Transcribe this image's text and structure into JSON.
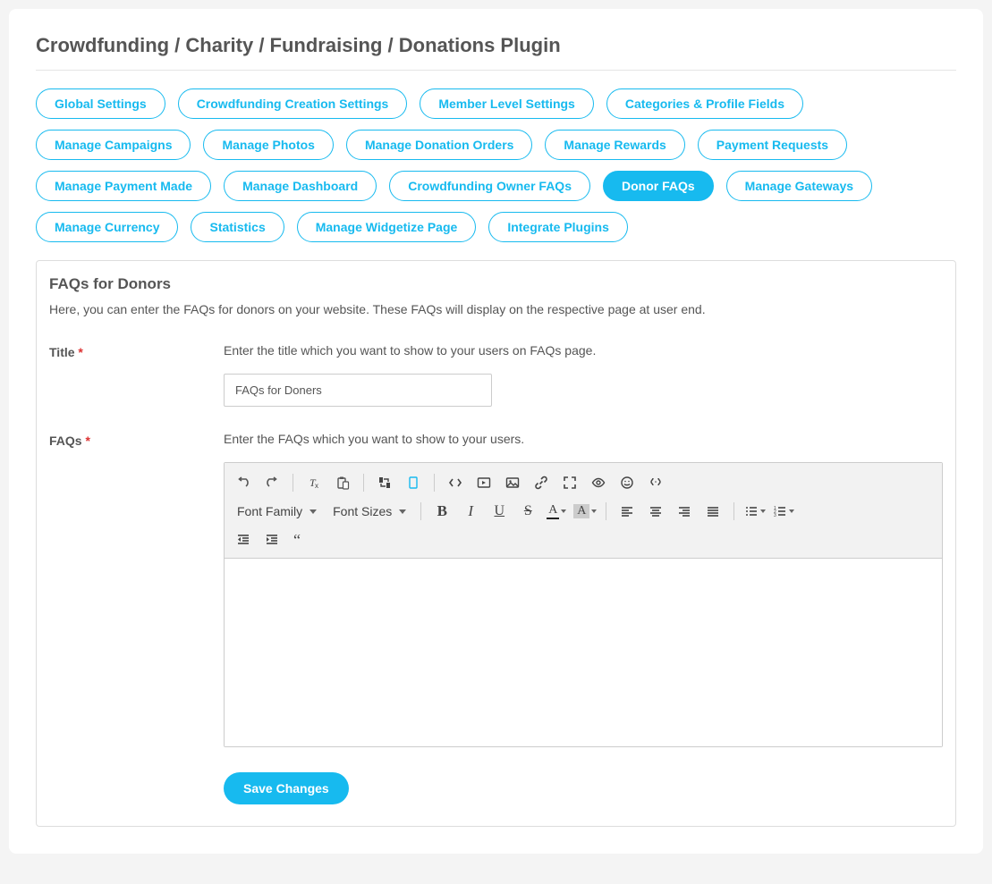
{
  "page_title": "Crowdfunding / Charity / Fundraising / Donations Plugin",
  "tabs": [
    {
      "label": "Global Settings",
      "active": false
    },
    {
      "label": "Crowdfunding Creation Settings",
      "active": false
    },
    {
      "label": "Member Level Settings",
      "active": false
    },
    {
      "label": "Categories & Profile Fields",
      "active": false
    },
    {
      "label": "Manage Campaigns",
      "active": false
    },
    {
      "label": "Manage Photos",
      "active": false
    },
    {
      "label": "Manage Donation Orders",
      "active": false
    },
    {
      "label": "Manage Rewards",
      "active": false
    },
    {
      "label": "Payment Requests",
      "active": false
    },
    {
      "label": "Manage Payment Made",
      "active": false
    },
    {
      "label": "Manage Dashboard",
      "active": false
    },
    {
      "label": "Crowdfunding Owner FAQs",
      "active": false
    },
    {
      "label": "Donor FAQs",
      "active": true
    },
    {
      "label": "Manage Gateways",
      "active": false
    },
    {
      "label": "Manage Currency",
      "active": false
    },
    {
      "label": "Statistics",
      "active": false
    },
    {
      "label": "Manage Widgetize Page",
      "active": false
    },
    {
      "label": "Integrate Plugins",
      "active": false
    }
  ],
  "form": {
    "heading": "FAQs for Donors",
    "description": "Here, you can enter the FAQs for donors on your website. These FAQs will display on the respective page at user end.",
    "title_field": {
      "label": "Title",
      "hint": "Enter the title which you want to show to your users on FAQs page.",
      "value": "FAQs for Doners"
    },
    "faqs_field": {
      "label": "FAQs",
      "hint": "Enter the FAQs which you want to show to your users.",
      "value": ""
    },
    "save_label": "Save Changes"
  },
  "editor": {
    "font_family_label": "Font Family",
    "font_sizes_label": "Font Sizes"
  }
}
